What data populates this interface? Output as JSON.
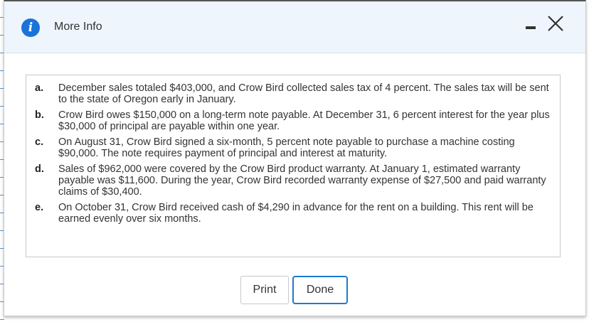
{
  "dialog": {
    "title": "More Info",
    "icon": "info-icon",
    "controls": {
      "minimize": "minimize-icon",
      "close": "close-icon"
    }
  },
  "items": [
    {
      "letter": "a.",
      "text": "December sales totaled $403,000, and Crow Bird collected sales tax of 4 percent. The sales tax will be sent to the state of Oregon early in January."
    },
    {
      "letter": "b.",
      "text": "Crow Bird owes $150,000 on a long-term note payable. At December 31, 6 percent interest for the year plus $30,000 of principal are payable within one year."
    },
    {
      "letter": "c.",
      "text": "On August 31, Crow Bird signed a six-month, 5 percent note payable to purchase a machine costing $90,000. The note requires payment of principal and interest at maturity."
    },
    {
      "letter": "d.",
      "text": "Sales of $962,000 were covered by the Crow Bird product warranty. At January 1, estimated warranty payable was $11,600. During the year, Crow Bird recorded warranty expense of $27,500 and paid warranty claims of $30,400."
    },
    {
      "letter": "e.",
      "text": "On October 31, Crow Bird received cash of $4,290 in advance for the rent on a building. This rent will be earned evenly over six months."
    }
  ],
  "buttons": {
    "print": "Print",
    "done": "Done"
  },
  "colors": {
    "accent": "#1a73d9",
    "header_bg": "#eef5fc",
    "focus_border": "#1e7ad0"
  }
}
